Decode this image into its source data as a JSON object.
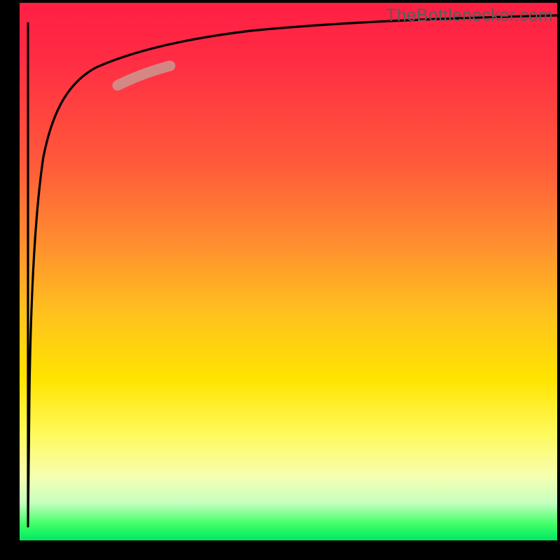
{
  "watermark": "TheBottlenecker.com",
  "chart_data": {
    "type": "line",
    "title": "",
    "xlabel": "",
    "ylabel": "",
    "xlim": [
      0,
      100
    ],
    "ylim": [
      0,
      100
    ],
    "background_gradient": {
      "top": "#ff1f44",
      "mid_upper": "#ff8f2f",
      "mid": "#ffe400",
      "mid_lower": "#f6ffb0",
      "bottom": "#00e865"
    },
    "series": [
      {
        "name": "bottleneck-curve",
        "color": "#000000",
        "x": [
          1.5,
          1.6,
          2.0,
          3.0,
          4.0,
          5.5,
          8.0,
          12.0,
          18.0,
          25.0,
          35.0,
          50.0,
          70.0,
          100.0
        ],
        "y": [
          2.0,
          40.0,
          58.0,
          70.0,
          76.0,
          80.0,
          84.0,
          87.5,
          90.0,
          91.8,
          93.0,
          94.2,
          95.0,
          95.8
        ]
      },
      {
        "name": "highlight-segment",
        "color": "#cf8f8b",
        "x": [
          18.0,
          25.0
        ],
        "y": [
          84.5,
          87.0
        ]
      }
    ],
    "note": "Axis values are estimated from pixel positions; chart has no tick labels."
  }
}
